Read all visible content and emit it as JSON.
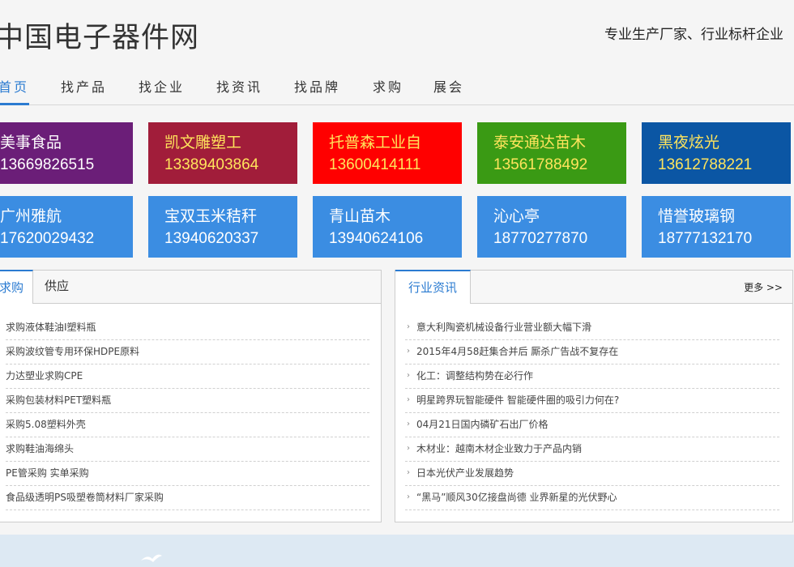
{
  "header": {
    "logo": "中国电子器件网",
    "slogan": "专业生产厂家、行业标杆企业"
  },
  "nav": [
    {
      "label": "首页",
      "active": true
    },
    {
      "label": "找产品",
      "active": false
    },
    {
      "label": "找企业",
      "active": false
    },
    {
      "label": "找资讯",
      "active": false
    },
    {
      "label": "找品牌",
      "active": false
    },
    {
      "label": "求购",
      "active": false
    },
    {
      "label": "展会",
      "active": false
    }
  ],
  "tiles": [
    {
      "name": "美事食品",
      "phone": "13669826515",
      "bg": "#6b1e78",
      "fg": "#ffffff"
    },
    {
      "name": "凯文雕塑工",
      "phone": "13389403864",
      "bg": "#a11d3a",
      "fg": "#ffe45c"
    },
    {
      "name": "托普森工业自",
      "phone": "13600414111",
      "bg": "#ff0000",
      "fg": "#ffe45c"
    },
    {
      "name": "泰安通达苗木",
      "phone": "13561788492",
      "bg": "#3a9a14",
      "fg": "#ffe45c"
    },
    {
      "name": "黑夜炫光",
      "phone": "13612788221",
      "bg": "#0b56a4",
      "fg": "#ffe45c"
    },
    {
      "name": "广州雅航",
      "phone": "17620029432",
      "bg": "#3b8de2",
      "fg": "#ffffff"
    },
    {
      "name": "宝双玉米秸秆",
      "phone": "13940620337",
      "bg": "#3b8de2",
      "fg": "#ffffff"
    },
    {
      "name": "青山苗木",
      "phone": "13940624106",
      "bg": "#3b8de2",
      "fg": "#ffffff"
    },
    {
      "name": "沁心亭",
      "phone": "18770277870",
      "bg": "#3b8de2",
      "fg": "#ffffff"
    },
    {
      "name": "惜誉玻璃钢",
      "phone": "18777132170",
      "bg": "#3b8de2",
      "fg": "#ffffff"
    }
  ],
  "left_panel": {
    "tabs": [
      "求购",
      "供应"
    ],
    "items": [
      "求购液体鞋油I塑料瓶",
      "采购波纹管专用环保HDPE原料",
      "力达塑业求购CPE",
      "采购包装材料PET塑料瓶",
      "采购5.08塑料外壳",
      "求购鞋油海绵头",
      "PE管采购 实单采购",
      "食品级透明PS吸塑卷筒材料厂家采购"
    ]
  },
  "right_panel": {
    "tab": "行业资讯",
    "more": "更多 >>",
    "bullet": "›",
    "items": [
      "意大利陶瓷机械设备行业营业额大幅下滑",
      "2015年4月58赶集合并后 厮杀广告战不复存在",
      "化工：调整结构势在必行作",
      "明星跨界玩智能硬件 智能硬件圈的吸引力何在?",
      "04月21日国内磷矿石出厂价格",
      "木材业：越南木材企业致力于产品内销",
      "日本光伏产业发展趋势",
      "“黑马”顺风30亿接盘尚德 业界新星的光伏野心"
    ]
  },
  "colors": {
    "accent": "#2b7bd1",
    "banner": "#dde9f3"
  },
  "icons": [
    "bird-icon",
    "bullet-arrow-icon"
  ]
}
